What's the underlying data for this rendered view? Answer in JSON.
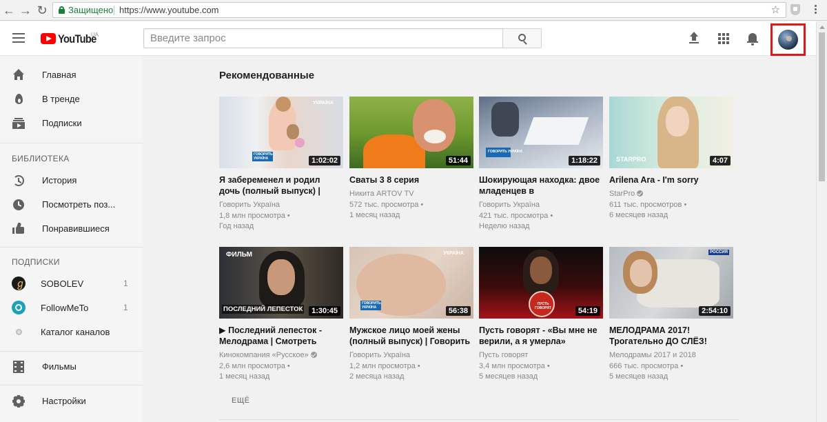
{
  "browser": {
    "secure_label": "Защищено",
    "url": "https://www.youtube.com"
  },
  "masthead": {
    "logo_text": "YouTube",
    "region": "UA",
    "search_placeholder": "Введите запрос"
  },
  "sidebar": {
    "main_items": [
      {
        "label": "Главная",
        "icon": "home-icon"
      },
      {
        "label": "В тренде",
        "icon": "flame-icon"
      },
      {
        "label": "Подписки",
        "icon": "subscriptions-icon"
      }
    ],
    "library_heading": "БИБЛИОТЕКА",
    "library_items": [
      {
        "label": "История",
        "icon": "history-icon"
      },
      {
        "label": "Посмотреть поз...",
        "icon": "watch-later-icon"
      },
      {
        "label": "Понравившиеся",
        "icon": "thumbs-up-icon"
      }
    ],
    "subs_heading": "ПОДПИСКИ",
    "subscriptions": [
      {
        "label": "SOBOLEV",
        "count": "1"
      },
      {
        "label": "FollowMeTo",
        "count": "1"
      },
      {
        "label": "Каталог каналов",
        "count": ""
      }
    ],
    "films_label": "Фильмы",
    "settings_label": "Настройки"
  },
  "main": {
    "section_title": "Рекомендованные",
    "more_label": "ЕЩЁ",
    "videos": [
      {
        "title": "Я забеременел и родил дочь (полный выпуск) |",
        "channel": "Говорить Україна",
        "views": "1,8 млн просмотра",
        "age": "Год назад",
        "duration": "1:02:02",
        "verified": false
      },
      {
        "title": "Сваты 3 8 серия",
        "channel": "Никита ARTOV TV",
        "views": "572 тыс. просмотра",
        "age": "1 месяц назад",
        "duration": "51:44",
        "verified": false
      },
      {
        "title": "Шокирующая находка: двое младенцев в",
        "channel": "Говорить Україна",
        "views": "421 тыс. просмотра",
        "age": "Неделю назад",
        "duration": "1:18:22",
        "verified": false
      },
      {
        "title": "Arilena Ara - I'm sorry",
        "channel": "StarPro",
        "views": "611 тыс. просмотров",
        "age": "6 месяцев назад",
        "duration": "4:07",
        "verified": true
      },
      {
        "title": "▶ Последний лепесток - Мелодрама | Смотреть",
        "channel": "Кинокомпания «Русское»",
        "views": "2,6 млн просмотра",
        "age": "1 месяц назад",
        "duration": "1:30:45",
        "verified": true
      },
      {
        "title": "Мужское лицо моей жены (полный выпуск) | Говорить",
        "channel": "Говорить Україна",
        "views": "1,2 млн просмотра",
        "age": "2 месяца назад",
        "duration": "56:38",
        "verified": false
      },
      {
        "title": "Пусть говорят - «Вы мне не верили, а я умерла»",
        "channel": "Пусть говорят",
        "views": "3,4 млн просмотра",
        "age": "5 месяцев назад",
        "duration": "54:19",
        "verified": false
      },
      {
        "title": "МЕЛОДРАМА 2017! Трогательно ДО СЛЁЗ!",
        "channel": "Мелодрамы 2017 и 2018",
        "views": "666 тыс. просмотра",
        "age": "5 месяцев назад",
        "duration": "2:54:10",
        "verified": false
      }
    ]
  },
  "thumb_texts": {
    "ukraina": "УКРАЇНА",
    "govoryt": "ГОВОРИТЬ УКРАЇНА",
    "starpro": "STARPRO",
    "film": "ФИЛЬМ",
    "last_petal": "ПОСЛЕДНИЙ ЛЕПЕСТОК",
    "pust": "ПУСТЬ ГОВОРЯТ",
    "russia": "РОССИЯ"
  },
  "colors": {
    "youtube_red": "#ff0000",
    "highlight_border": "#d61c1c",
    "secure_green": "#188038"
  }
}
